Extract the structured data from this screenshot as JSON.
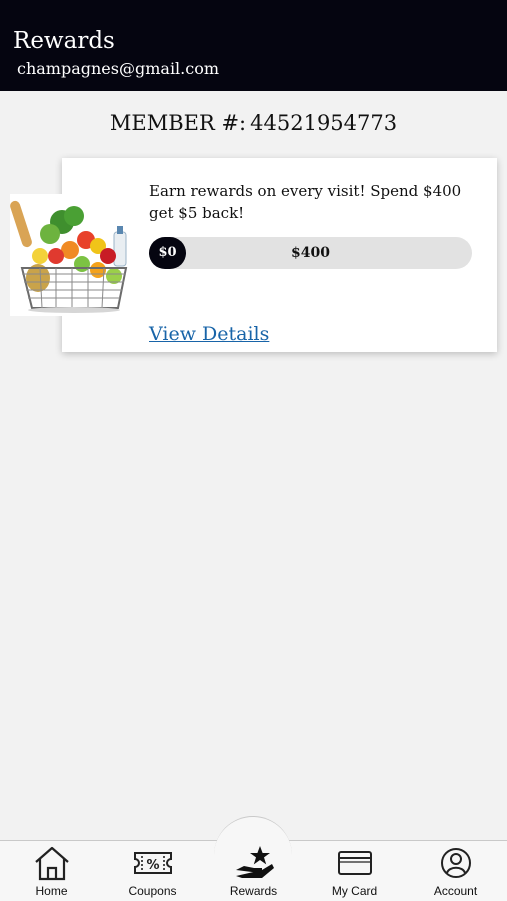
{
  "header": {
    "title": "Rewards",
    "email": "champagnes@gmail.com"
  },
  "member": {
    "label": "MEMBER #:",
    "number": "44521954773"
  },
  "reward_card": {
    "image": "grocery-basket-icon",
    "description": "Earn rewards on every visit! Spend $400 get $5 back!",
    "progress": {
      "current_label": "$0",
      "target_label": "$400",
      "fraction": 0
    },
    "details_link": "View Details"
  },
  "tabs": [
    {
      "label": "Home",
      "icon": "home-icon"
    },
    {
      "label": "Coupons",
      "icon": "coupon-icon"
    },
    {
      "label": "Rewards",
      "icon": "rewards-icon",
      "active": true
    },
    {
      "label": "My Card",
      "icon": "card-icon"
    },
    {
      "label": "Account",
      "icon": "account-icon"
    }
  ],
  "colors": {
    "header_bg": "#050510",
    "link": "#1864a8",
    "background": "#f2f2f2"
  }
}
